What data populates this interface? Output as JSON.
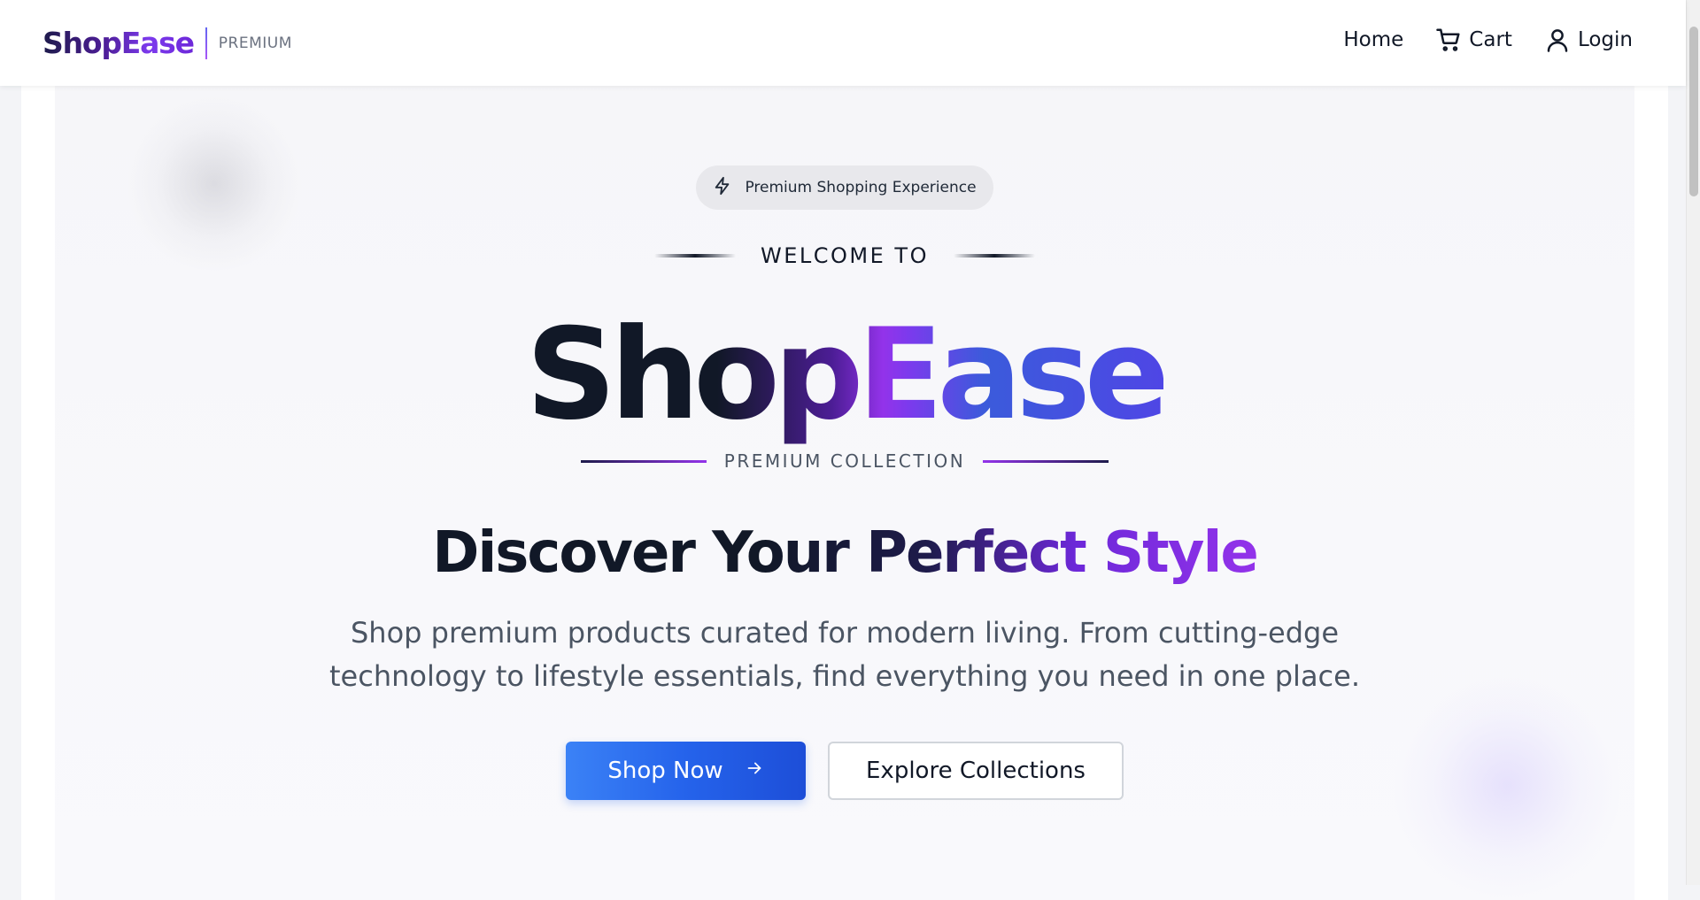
{
  "navbar": {
    "brand": "ShopEase",
    "brand_tag": "PREMIUM",
    "links": [
      {
        "label": "Home",
        "icon": "none"
      },
      {
        "label": "Cart",
        "icon": "cart-icon"
      },
      {
        "label": "Login",
        "icon": "user-icon"
      }
    ]
  },
  "hero": {
    "pill_label": "Premium Shopping Experience",
    "pill_icon": "lightning-icon",
    "welcome": "WELCOME TO",
    "logo": "ShopEase",
    "collection": "PREMIUM COLLECTION",
    "headline": "Discover Your Perfect Style",
    "subtitle": "Shop premium products curated for modern living. From cutting-edge technology to lifestyle essentials, find everything you need in one place.",
    "primary_button": "Shop Now",
    "primary_button_icon": "arrow-right-icon",
    "secondary_button": "Explore Collections"
  },
  "colors": {
    "accent_blue": "#2563eb",
    "accent_purple": "#7c3aed",
    "text_dark": "#111827",
    "text_muted": "#4b5563"
  }
}
